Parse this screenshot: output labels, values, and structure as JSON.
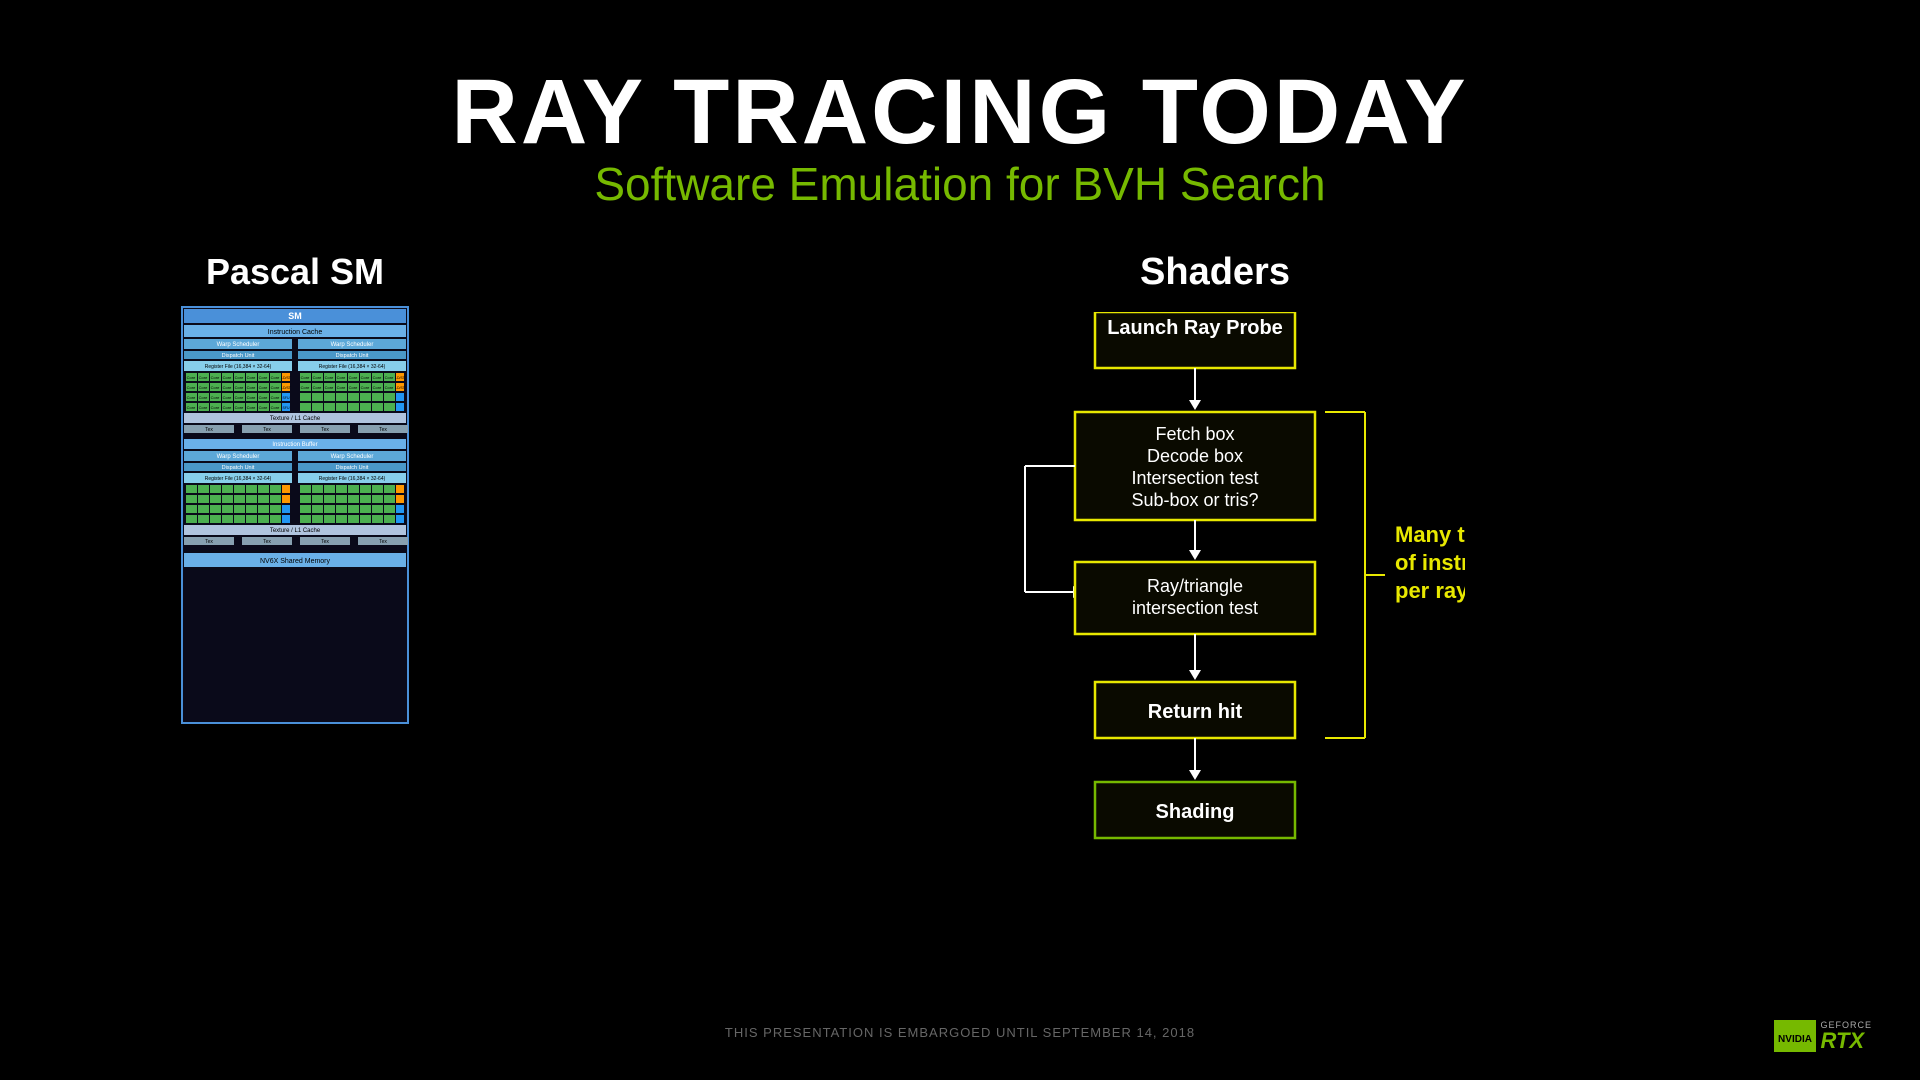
{
  "title": {
    "main": "RAY TRACING TODAY",
    "sub": "Software Emulation for BVH Search"
  },
  "pascal": {
    "label": "Pascal SM"
  },
  "shaders": {
    "label": "Shaders"
  },
  "flowchart": {
    "boxes": [
      {
        "id": "launch-ray-probe",
        "text": "Launch Ray Probe",
        "border": "yellow"
      },
      {
        "id": "fetch-box",
        "text": "Fetch box\nDecode box\nIntersection test\nSub-box or tris?",
        "border": "yellow"
      },
      {
        "id": "ray-triangle",
        "text": "Ray/triangle\nintersection test",
        "border": "yellow"
      },
      {
        "id": "return-hit",
        "text": "Return hit",
        "border": "yellow"
      },
      {
        "id": "shading",
        "text": "Shading",
        "border": "green"
      }
    ]
  },
  "annotation": {
    "text": "Many thousands\nof instruction slots\nper ray"
  },
  "footer": {
    "watermark": "THIS PRESENTATION IS EMBARGOED UNTIL SEPTEMBER 14, 2018"
  },
  "nvidia": {
    "geforce": "GEFORCE",
    "rtx": "RTX"
  }
}
